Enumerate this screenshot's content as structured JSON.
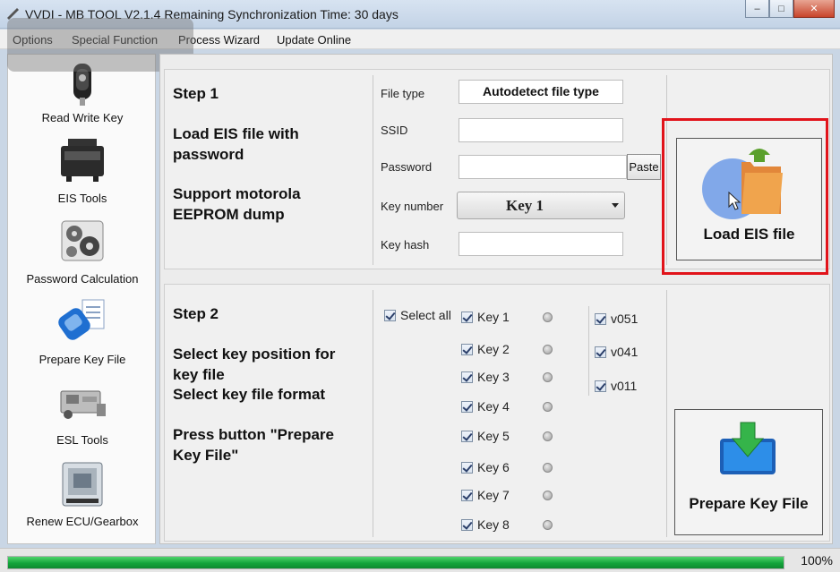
{
  "window": {
    "title": "VVDI - MB TOOL V2.1.4   Remaining Synchronization Time: 30 days",
    "minimize": "–",
    "maximize": "□",
    "close": "✕"
  },
  "menu": {
    "items": [
      "Options",
      "Special Function",
      "Process Wizard",
      "Update Online"
    ]
  },
  "sidebar": {
    "items": [
      {
        "label": "Read Write Key",
        "icon": "key-icon"
      },
      {
        "label": "EIS Tools",
        "icon": "eis-module-icon"
      },
      {
        "label": "Password Calculation",
        "icon": "gears-icon"
      },
      {
        "label": "Prepare Key File",
        "icon": "key-file-icon",
        "selected": true
      },
      {
        "label": "ESL Tools",
        "icon": "esl-icon"
      },
      {
        "label": "Renew ECU/Gearbox",
        "icon": "ecu-icon"
      }
    ]
  },
  "step1": {
    "title": "Step 1",
    "line1": "Load EIS file with",
    "line2": "password",
    "line3": "Support motorola",
    "line4": "EEPROM dump",
    "fields": {
      "file_type_label": "File type",
      "file_type_value": "Autodetect file type",
      "ssid_label": "SSID",
      "ssid_value": "",
      "password_label": "Password",
      "password_value": "",
      "paste_label": "Paste",
      "key_number_label": "Key number",
      "key_number_value": "Key 1",
      "key_hash_label": "Key hash",
      "key_hash_value": ""
    },
    "load_button": "Load EIS file"
  },
  "step2": {
    "title": "Step 2",
    "line1": "Select key position for",
    "line2": "key file",
    "line3": "Select key file format",
    "line4": "Press button \"Prepare",
    "line5": "Key File\"",
    "select_all": "Select all",
    "keys": [
      "Key 1",
      "Key 2",
      "Key 3",
      "Key 4",
      "Key 5",
      "Key 6",
      "Key 7",
      "Key 8"
    ],
    "formats": [
      "v051",
      "v041",
      "v011"
    ],
    "prepare_button": "Prepare Key File"
  },
  "status": {
    "progress_percent": 100,
    "progress_text": "100%"
  },
  "colors": {
    "highlight_frame": "#e1131a",
    "progress_green": "#13a43b"
  }
}
